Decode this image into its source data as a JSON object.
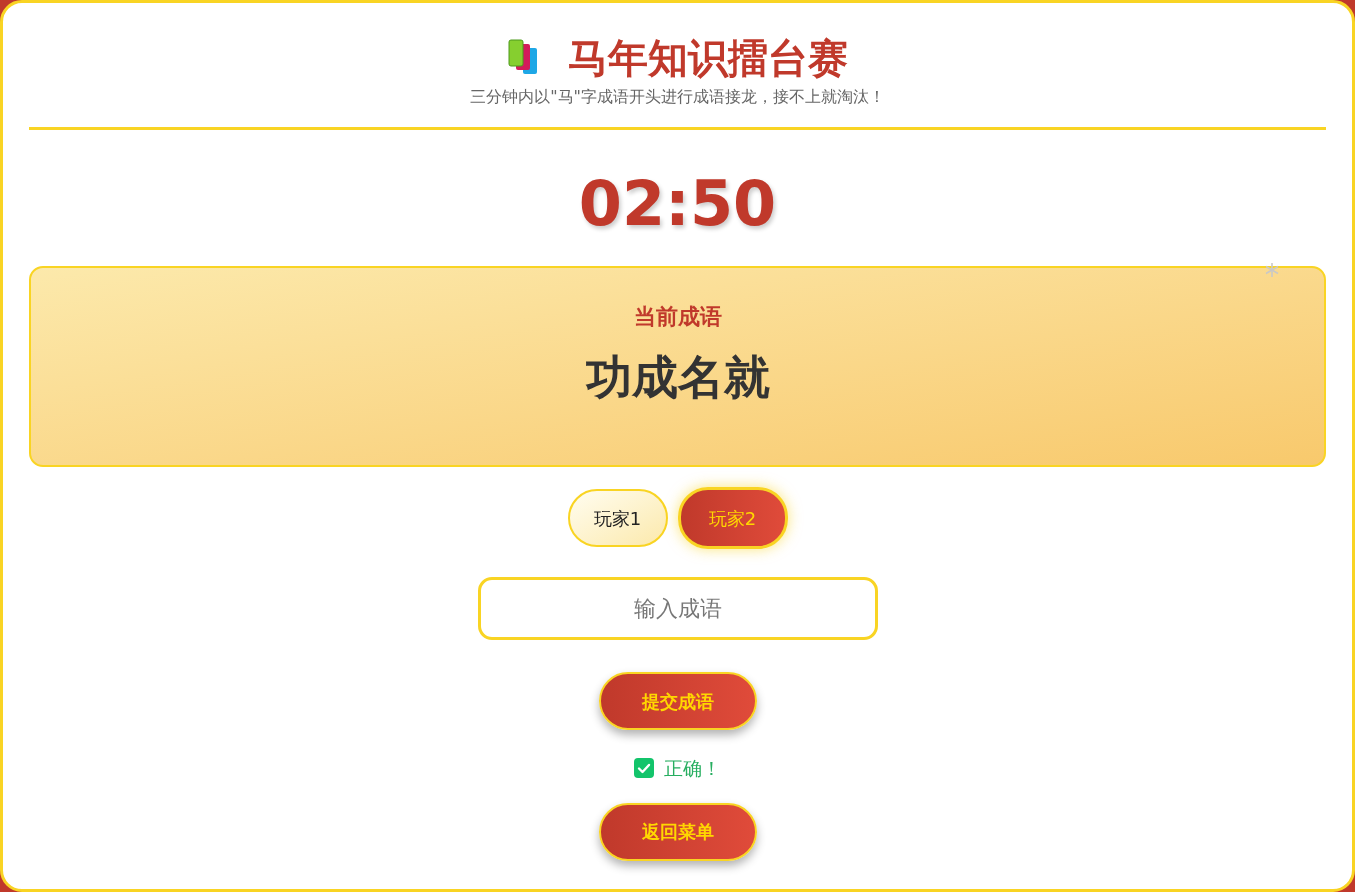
{
  "header": {
    "title": "马年知识擂台赛",
    "subtitle": "三分钟内以\"马\"字成语开头进行成语接龙，接不上就淘汰！"
  },
  "timer": "02:50",
  "current": {
    "label": "当前成语",
    "idiom": "功成名就"
  },
  "players": [
    {
      "label": "玩家1",
      "selected": false
    },
    {
      "label": "玩家2",
      "selected": true
    }
  ],
  "answer_field": {
    "placeholder": "输入成语"
  },
  "submit_button": "提交成语",
  "feedback": {
    "kind": "correct",
    "text": "正确！"
  },
  "back_button": "返回菜单"
}
